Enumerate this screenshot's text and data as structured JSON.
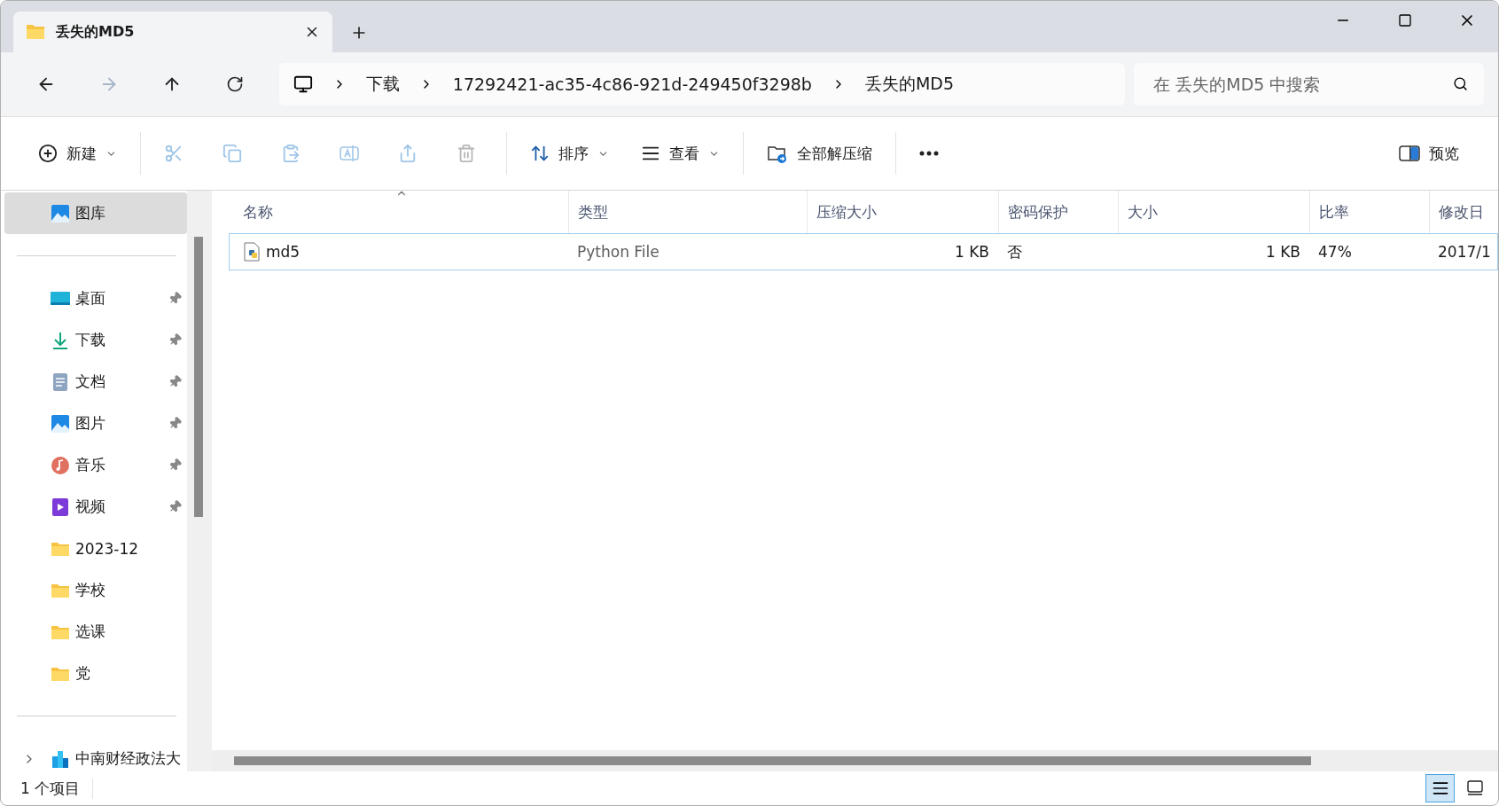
{
  "tabs": [
    {
      "title": "丢失的MD5",
      "selected": true
    }
  ],
  "nav": {
    "back_disabled": false,
    "forward_disabled": true,
    "breadcrumb": [
      "下载",
      "17292421-ac35-4c86-921d-249450f3298b",
      "丢失的MD5"
    ],
    "search": {
      "placeholder": "在 丢失的MD5 中搜索"
    }
  },
  "toolbar": [
    {
      "kind": "new",
      "label": "新建",
      "dropdown": true,
      "disabled": false
    },
    {
      "kind": "separator"
    },
    {
      "kind": "cut",
      "disabled": true
    },
    {
      "kind": "copy",
      "disabled": true
    },
    {
      "kind": "paste",
      "disabled": true
    },
    {
      "kind": "rename",
      "disabled": true
    },
    {
      "kind": "share",
      "disabled": true
    },
    {
      "kind": "delete",
      "disabled": true
    },
    {
      "kind": "separator"
    },
    {
      "kind": "sort",
      "label": "排序",
      "dropdown": true,
      "disabled": false
    },
    {
      "kind": "view",
      "label": "查看",
      "dropdown": true,
      "disabled": false
    },
    {
      "kind": "separator"
    },
    {
      "kind": "extract",
      "label": "全部解压缩",
      "dropdown": false,
      "disabled": false
    },
    {
      "kind": "separator"
    },
    {
      "kind": "more"
    }
  ],
  "preview_button": {
    "label": "预览"
  },
  "sidebar": {
    "items": [
      {
        "kind": "gallery",
        "label": "图库",
        "selected": true,
        "pinned": false
      },
      {
        "kind": "divider"
      },
      {
        "kind": "desktop",
        "label": "桌面",
        "selected": false,
        "pinned": true
      },
      {
        "kind": "download",
        "label": "下载",
        "selected": false,
        "pinned": true
      },
      {
        "kind": "document",
        "label": "文档",
        "selected": false,
        "pinned": true
      },
      {
        "kind": "pictures",
        "label": "图片",
        "selected": false,
        "pinned": true
      },
      {
        "kind": "music",
        "label": "音乐",
        "selected": false,
        "pinned": true
      },
      {
        "kind": "video",
        "label": "视频",
        "selected": false,
        "pinned": true
      },
      {
        "kind": "folder",
        "label": "2023-12",
        "selected": false,
        "pinned": false
      },
      {
        "kind": "folder",
        "label": "学校",
        "selected": false,
        "pinned": false
      },
      {
        "kind": "folder",
        "label": "选课",
        "selected": false,
        "pinned": false
      },
      {
        "kind": "folder",
        "label": "党",
        "selected": false,
        "pinned": false
      },
      {
        "kind": "divider"
      },
      {
        "kind": "cloud",
        "label": "中南财经政法大",
        "selected": false,
        "pinned": false,
        "expandable": true
      }
    ]
  },
  "table": {
    "columns": [
      {
        "label": "名称",
        "sorted": true
      },
      {
        "label": "类型",
        "sorted": false
      },
      {
        "label": "压缩大小",
        "sorted": false
      },
      {
        "label": "密码保护",
        "sorted": false
      },
      {
        "label": "大小",
        "sorted": false
      },
      {
        "label": "比率",
        "sorted": false
      },
      {
        "label": "修改日",
        "sorted": false
      }
    ],
    "rows": [
      {
        "selected": true,
        "kind": "python",
        "cells": [
          "md5",
          "Python File",
          "1 KB",
          "否",
          "1 KB",
          "47%",
          "2017/1"
        ]
      }
    ]
  },
  "status_bar": {
    "text": "1 个项目",
    "views": [
      {
        "kind": "details",
        "selected": true
      },
      {
        "kind": "tiles",
        "selected": false
      }
    ]
  }
}
